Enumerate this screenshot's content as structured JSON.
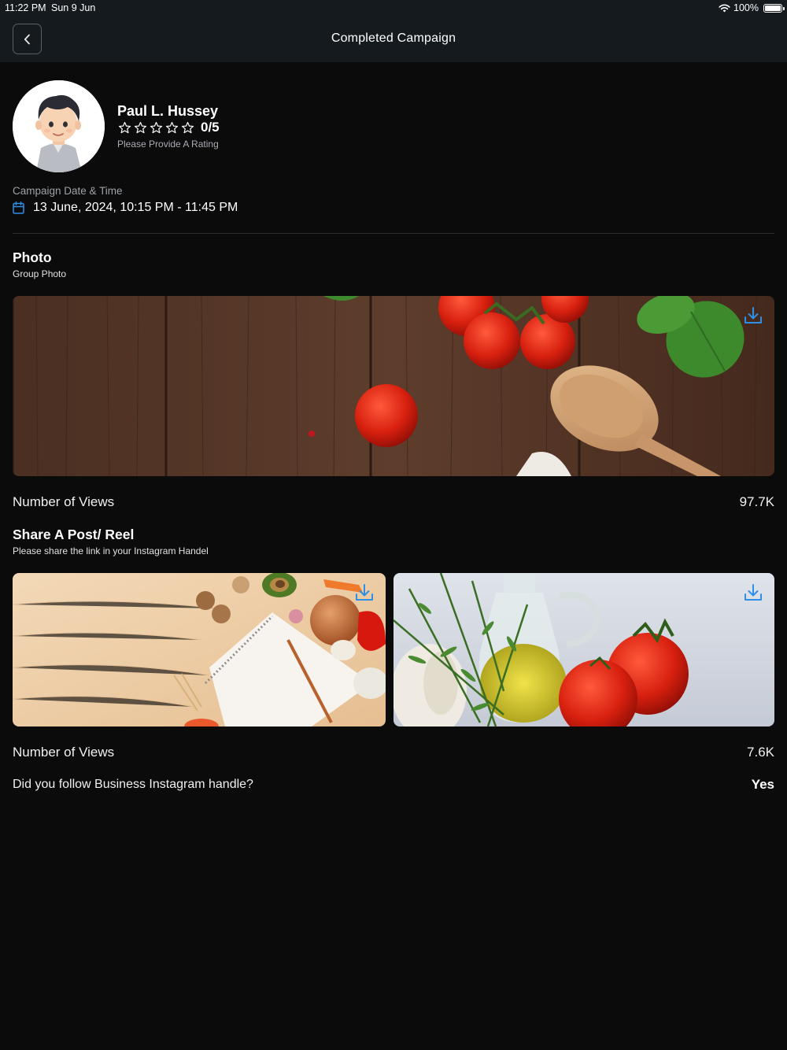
{
  "status_bar": {
    "time": "11:22 PM",
    "date": "Sun 9 Jun",
    "battery": "100%"
  },
  "header": {
    "title": "Completed Campaign"
  },
  "profile": {
    "name": "Paul L. Hussey",
    "rating": "0/5",
    "rating_hint": "Please Provide A Rating",
    "stars": 0,
    "max_stars": 5
  },
  "campaign": {
    "date_label": "Campaign Date & Time",
    "date_value": "13 June, 2024, 10:15 PM - 11:45 PM"
  },
  "photo_section": {
    "title": "Photo",
    "subtitle": "Group Photo",
    "views_label": "Number of Views",
    "views_value": "97.7K"
  },
  "share_section": {
    "title": "Share A Post/ Reel",
    "subtitle": "Please share the link in your Instagram Handel",
    "views_label": "Number of Views",
    "views_value": "7.6K"
  },
  "follow": {
    "question": "Did you follow Business Instagram handle?",
    "answer": "Yes"
  },
  "colors": {
    "background": "#0b0b0b",
    "header": "#151a1f",
    "accent": "#2f8fe8"
  }
}
